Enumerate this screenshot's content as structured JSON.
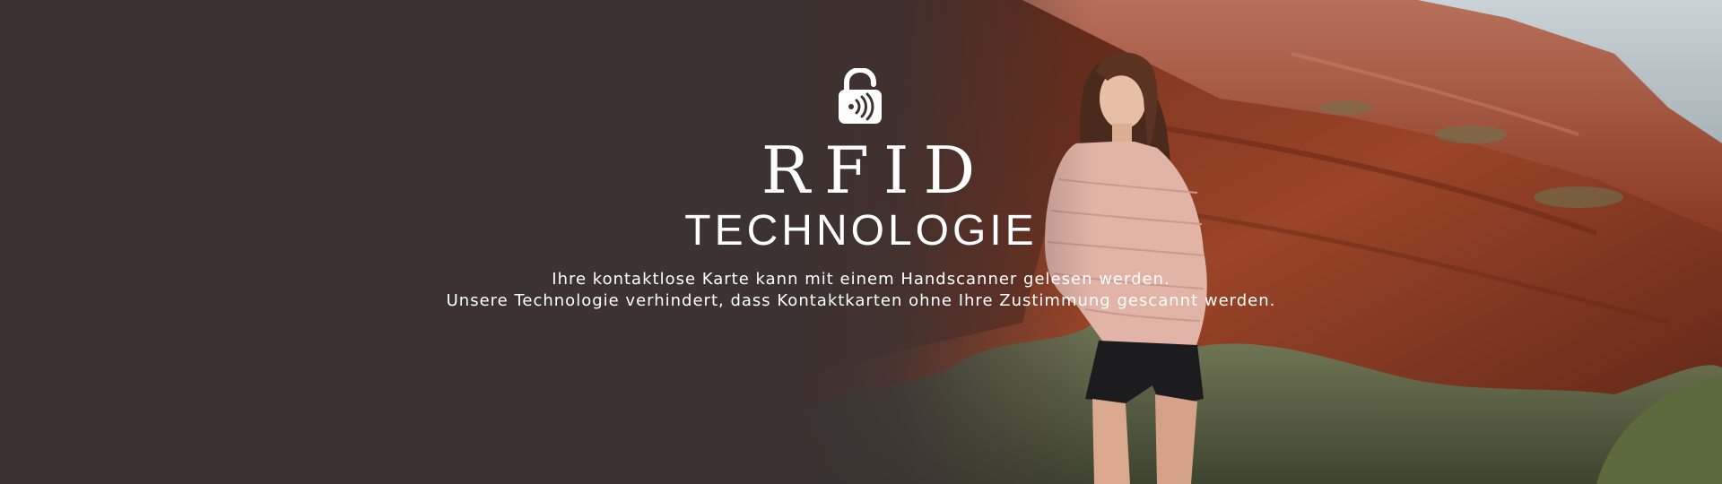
{
  "banner": {
    "icon": "rfid-lock-icon",
    "title": "RFID",
    "subtitle": "TECHNOLOGIE",
    "description": [
      "Ihre kontaktlose Karte kann mit einem Handscanner gelesen werden.",
      "Unsere Technologie verhindert, dass Kontaktkarten ohne Ihre Zustimmung gescannt werden."
    ],
    "colors": {
      "background": "#3b3231",
      "text": "#ffffff",
      "rock": "#8a3d24",
      "jacket": "#e2b4a8"
    }
  }
}
